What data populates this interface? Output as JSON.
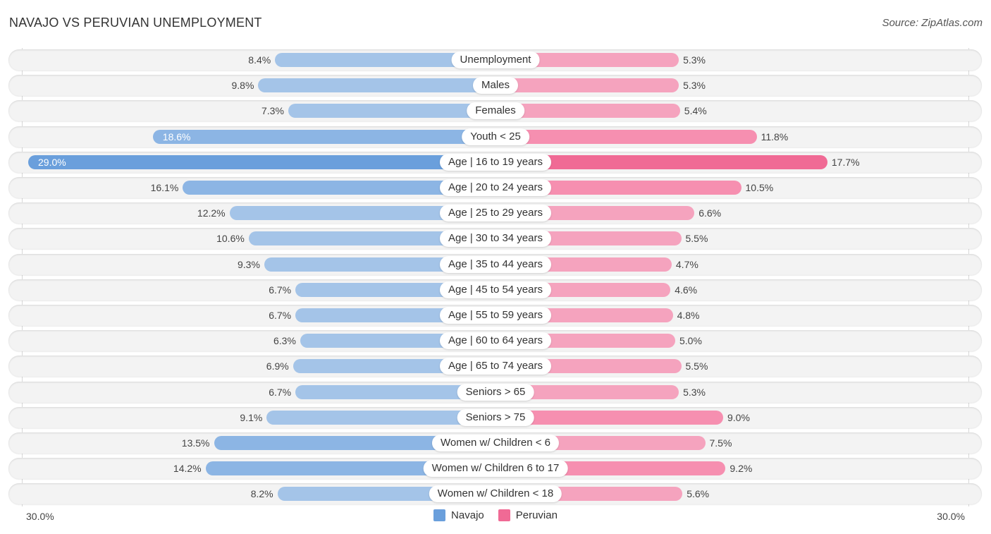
{
  "title": "NAVAJO VS PERUVIAN UNEMPLOYMENT",
  "source": "Source: ZipAtlas.com",
  "colors": {
    "navajo": "#6a9fdc",
    "peruvian": "#f06a95"
  },
  "chart_data": {
    "type": "bar",
    "orientation": "horizontal-diverging",
    "title": "NAVAJO VS PERUVIAN UNEMPLOYMENT",
    "xlabel": "",
    "ylabel": "",
    "xlim": [
      0,
      30.0
    ],
    "axis_labels": {
      "left": "30.0%",
      "right": "30.0%"
    },
    "legend": {
      "position": "bottom-center",
      "entries": [
        "Navajo",
        "Peruvian"
      ]
    },
    "categories": [
      "Unemployment",
      "Males",
      "Females",
      "Youth < 25",
      "Age | 16 to 19 years",
      "Age | 20 to 24 years",
      "Age | 25 to 29 years",
      "Age | 30 to 34 years",
      "Age | 35 to 44 years",
      "Age | 45 to 54 years",
      "Age | 55 to 59 years",
      "Age | 60 to 64 years",
      "Age | 65 to 74 years",
      "Seniors > 65",
      "Seniors > 75",
      "Women w/ Children < 6",
      "Women w/ Children 6 to 17",
      "Women w/ Children < 18"
    ],
    "series": [
      {
        "name": "Navajo",
        "side": "left",
        "values": [
          8.4,
          9.8,
          7.3,
          18.6,
          29.0,
          16.1,
          12.2,
          10.6,
          9.3,
          6.7,
          6.7,
          6.3,
          6.9,
          6.7,
          9.1,
          13.5,
          14.2,
          8.2
        ],
        "labels": [
          "8.4%",
          "9.8%",
          "7.3%",
          "18.6%",
          "29.0%",
          "16.1%",
          "12.2%",
          "10.6%",
          "9.3%",
          "6.7%",
          "6.7%",
          "6.3%",
          "6.9%",
          "6.7%",
          "9.1%",
          "13.5%",
          "14.2%",
          "8.2%"
        ]
      },
      {
        "name": "Peruvian",
        "side": "right",
        "values": [
          5.3,
          5.3,
          5.4,
          11.8,
          17.7,
          10.5,
          6.6,
          5.5,
          4.7,
          4.6,
          4.8,
          5.0,
          5.5,
          5.3,
          9.0,
          7.5,
          9.2,
          5.6
        ],
        "labels": [
          "5.3%",
          "5.3%",
          "5.4%",
          "11.8%",
          "17.7%",
          "10.5%",
          "6.6%",
          "5.5%",
          "4.7%",
          "4.6%",
          "4.8%",
          "5.0%",
          "5.5%",
          "5.3%",
          "9.0%",
          "7.5%",
          "9.2%",
          "5.6%"
        ]
      }
    ]
  }
}
